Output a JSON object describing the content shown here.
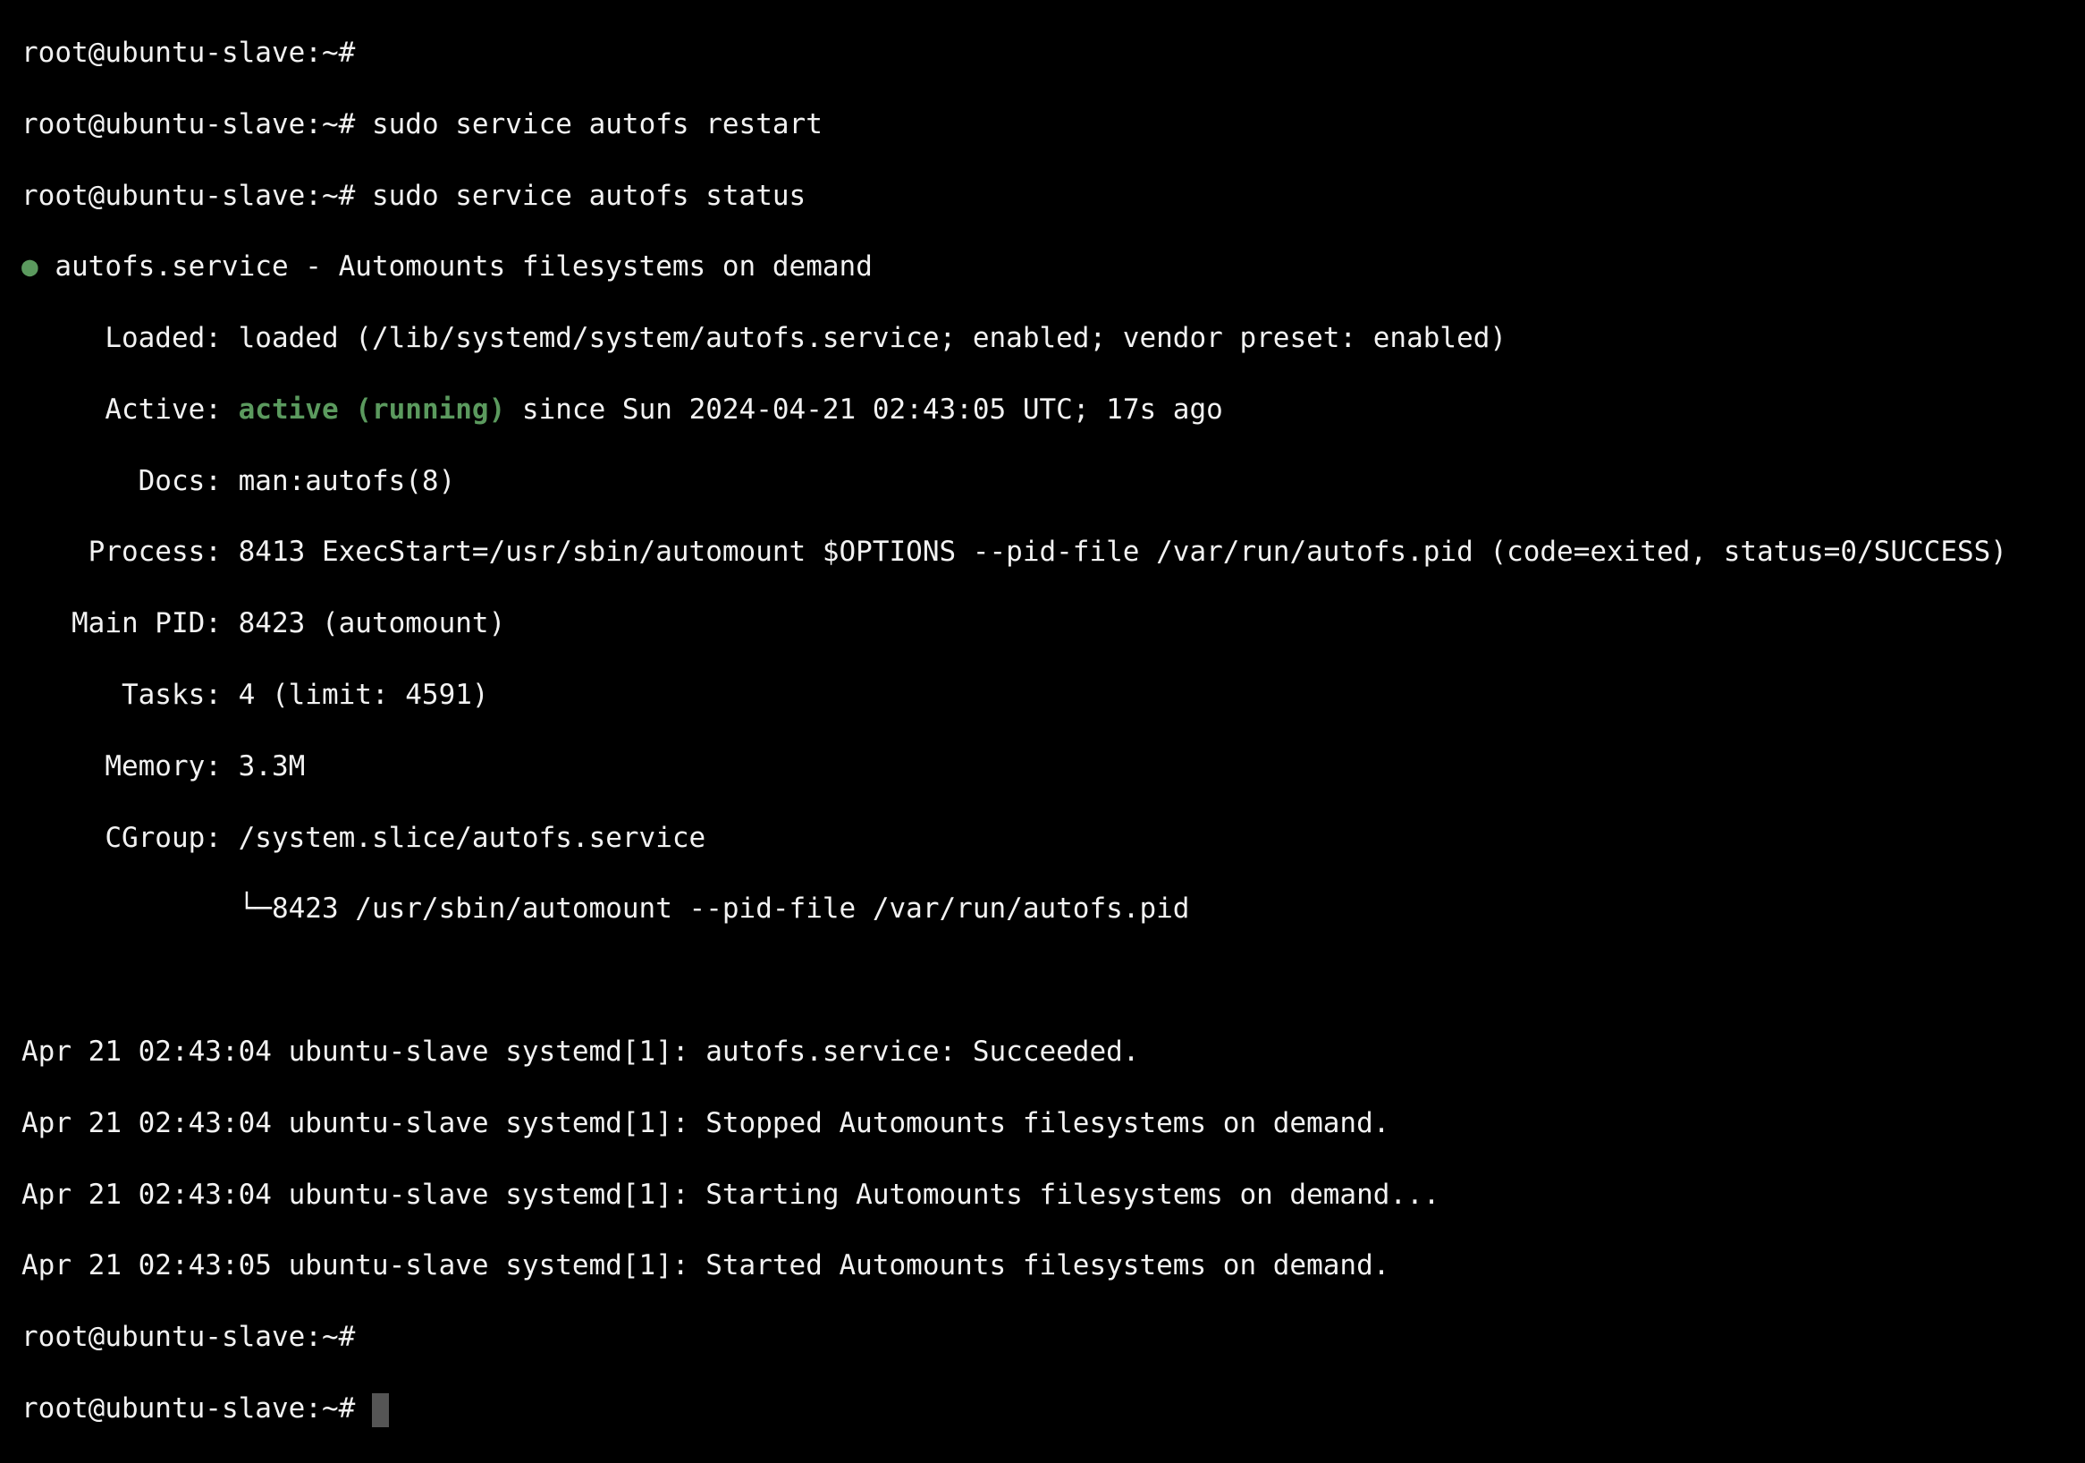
{
  "terminal": {
    "prompt": "root@ubuntu-slave:~#",
    "commands": [
      "",
      "sudo service autofs restart",
      "sudo service autofs status"
    ],
    "status": {
      "bullet": "●",
      "header": "autofs.service - Automounts filesystems on demand",
      "loaded_label": "     Loaded:",
      "loaded": " loaded (/lib/systemd/system/autofs.service; enabled; vendor preset: enabled)",
      "active_label": "     Active:",
      "active_state": "active (running)",
      "active_rest": " since Sun 2024-04-21 02:43:05 UTC; 17s ago",
      "docs_label": "       Docs:",
      "docs": " man:autofs(8)",
      "process_label": "    Process:",
      "process": " 8413 ExecStart=/usr/sbin/automount $OPTIONS --pid-file /var/run/autofs.pid (code=exited, status=0/SUCCESS)",
      "mainpid_label": "   Main PID:",
      "mainpid": " 8423 (automount)",
      "tasks_label": "      Tasks:",
      "tasks": " 4 (limit: 4591)",
      "memory_label": "     Memory:",
      "memory": " 3.3M",
      "cgroup_label": "     CGroup:",
      "cgroup": " /system.slice/autofs.service",
      "cgroup_child": "             └─8423 /usr/sbin/automount --pid-file /var/run/autofs.pid"
    },
    "log": [
      "Apr 21 02:43:04 ubuntu-slave systemd[1]: autofs.service: Succeeded.",
      "Apr 21 02:43:04 ubuntu-slave systemd[1]: Stopped Automounts filesystems on demand.",
      "Apr 21 02:43:04 ubuntu-slave systemd[1]: Starting Automounts filesystems on demand...",
      "Apr 21 02:43:05 ubuntu-slave systemd[1]: Started Automounts filesystems on demand."
    ],
    "colors": {
      "active": "#5b9a5e",
      "background": "#000000",
      "text": "#f2f2f2"
    }
  }
}
